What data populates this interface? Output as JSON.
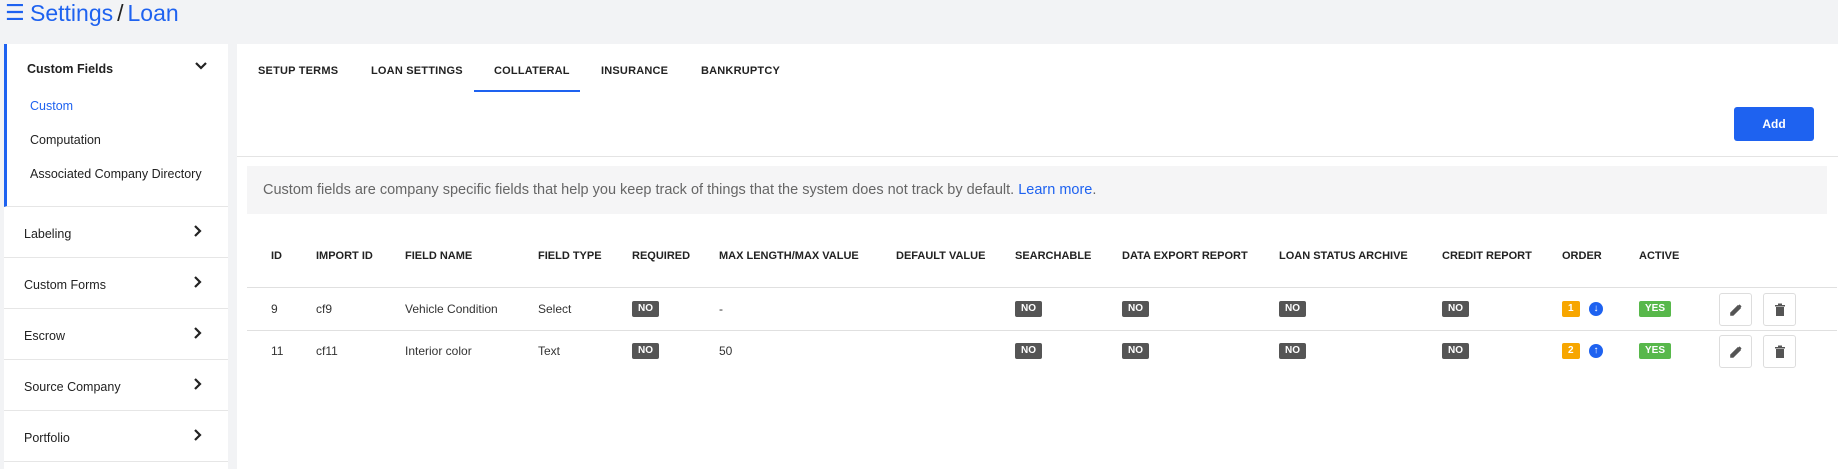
{
  "header": {
    "breadcrumb_root": "Settings",
    "separator": "/",
    "breadcrumb_current": "Loan"
  },
  "sidebar": {
    "group": {
      "label": "Custom Fields",
      "items": [
        "Custom",
        "Computation",
        "Associated Company Directory"
      ],
      "active_item": "Custom"
    },
    "items": [
      "Labeling",
      "Custom Forms",
      "Escrow",
      "Source Company",
      "Portfolio"
    ]
  },
  "tabs": [
    "SETUP TERMS",
    "LOAN SETTINGS",
    "COLLATERAL",
    "INSURANCE",
    "BANKRUPTCY"
  ],
  "active_tab": "COLLATERAL",
  "add_label": "Add",
  "notice": {
    "text": "Custom fields are company specific fields that help you keep track of things that the system does not track by default.",
    "link": "Learn more",
    "suffix": "."
  },
  "table": {
    "columns": [
      "ID",
      "IMPORT ID",
      "FIELD NAME",
      "FIELD TYPE",
      "REQUIRED",
      "MAX LENGTH/MAX VALUE",
      "DEFAULT VALUE",
      "SEARCHABLE",
      "DATA EXPORT REPORT",
      "LOAN STATUS ARCHIVE",
      "CREDIT REPORT",
      "ORDER",
      "ACTIVE"
    ],
    "rows": [
      {
        "id": "9",
        "import_id": "cf9",
        "field_name": "Vehicle Condition",
        "field_type": "Select",
        "required": "NO",
        "max": "-",
        "default": "",
        "searchable": "NO",
        "data_export": "NO",
        "loan_status_archive": "NO",
        "credit_report": "NO",
        "order": "1",
        "order_arrow": "down",
        "active": "YES"
      },
      {
        "id": "11",
        "import_id": "cf11",
        "field_name": "Interior color",
        "field_type": "Text",
        "required": "NO",
        "max": "50",
        "default": "",
        "searchable": "NO",
        "data_export": "NO",
        "loan_status_archive": "NO",
        "credit_report": "NO",
        "order": "2",
        "order_arrow": "up",
        "active": "YES"
      }
    ]
  },
  "colors": {
    "accent": "#1e62f0",
    "badge_no": "#555555",
    "badge_yes": "#58b84b",
    "badge_order": "#f7a600"
  }
}
